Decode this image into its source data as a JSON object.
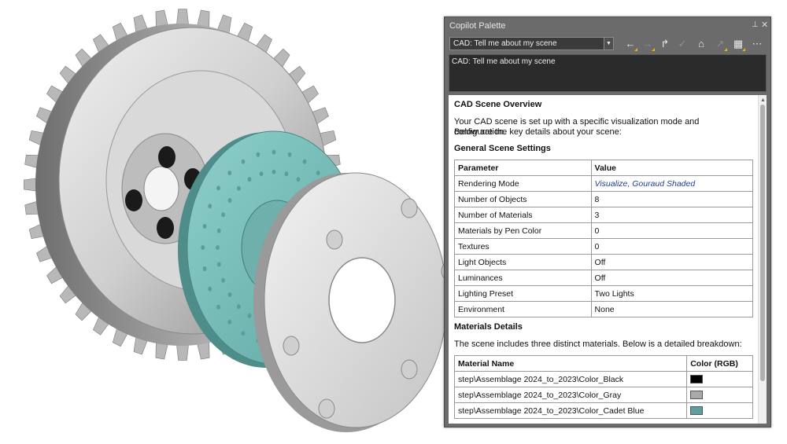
{
  "palette": {
    "title": "Copilot Palette",
    "pin_icon": "pin-icon",
    "close_icon": "close-icon",
    "prompt_selected": "CAD: Tell me about my scene",
    "input_text": "CAD: Tell me about my scene",
    "toolbar_icons": [
      "back-arrow-icon",
      "forward-arrow-icon",
      "share-icon",
      "checkmark-icon",
      "home-icon",
      "pointer-icon",
      "layout-icon",
      "more-icon"
    ]
  },
  "response": {
    "heading": "CAD Scene Overview",
    "intro_line1": "Your CAD scene is set up with a specific visualization mode and configuration.",
    "intro_line2": "Below are the key details about your scene:",
    "general_heading": "General Scene Settings",
    "general_table": {
      "headers": [
        "Parameter",
        "Value"
      ],
      "rows": [
        [
          "Rendering Mode",
          "Visualize, Gouraud Shaded"
        ],
        [
          "Number of Objects",
          "8"
        ],
        [
          "Number of Materials",
          "3"
        ],
        [
          "Materials by Pen Color",
          "0"
        ],
        [
          "Textures",
          "0"
        ],
        [
          "Light Objects",
          "Off"
        ],
        [
          "Luminances",
          "Off"
        ],
        [
          "Lighting Preset",
          "Two Lights"
        ],
        [
          "Environment",
          "None"
        ]
      ]
    },
    "materials_heading": "Materials Details",
    "materials_intro": "The scene includes three distinct materials. Below is a detailed breakdown:",
    "materials_table": {
      "headers": [
        "Material Name",
        "Color (RGB)"
      ],
      "rows": [
        {
          "name": "step\\Assemblage 2024_to_2023\\Color_Black",
          "color": "#000000"
        },
        {
          "name": "step\\Assemblage 2024_to_2023\\Color_Gray",
          "color": "#a9a9a9"
        },
        {
          "name": "step\\Assemblage 2024_to_2023\\Color_Cadet Blue",
          "color": "#5f9ea0"
        }
      ]
    }
  },
  "colors": {
    "gear_light": "#e2e2e2",
    "gear_dark": "#8a8a8a",
    "plate_teal": "#7fc0bc",
    "hub_black": "#151515",
    "palette_bg": "#6b6b6b"
  }
}
